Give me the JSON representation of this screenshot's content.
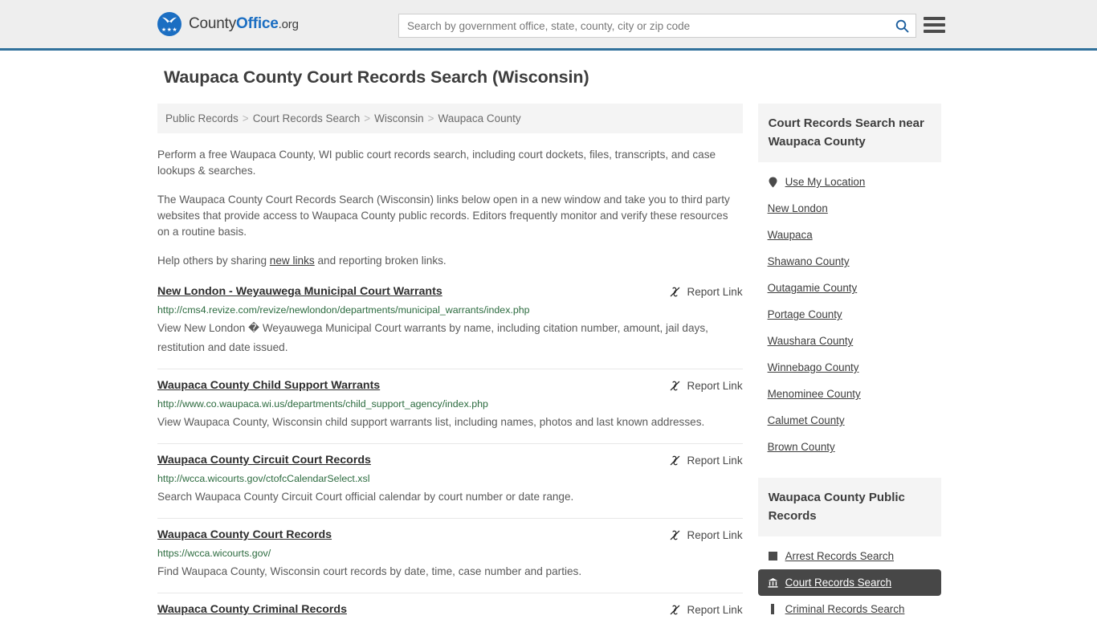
{
  "header": {
    "brand": {
      "part1": "County",
      "part2": "Office",
      "part3": ".org",
      "icon": "eagle-seal-logo",
      "stars": "★★★"
    },
    "search": {
      "placeholder": "Search by government office, state, county, city or zip code",
      "value": "",
      "icon": "search-icon"
    },
    "menu_icon": "hamburger-menu-icon",
    "accent_color": "#31719b",
    "bg_color": "#eeeeee"
  },
  "page": {
    "title": "Waupaca County Court Records Search (Wisconsin)"
  },
  "breadcrumb": {
    "separator": ">",
    "items": [
      {
        "label": "Public Records"
      },
      {
        "label": "Court Records Search"
      },
      {
        "label": "Wisconsin"
      },
      {
        "label": "Waupaca County"
      }
    ]
  },
  "intro": {
    "p1": "Perform a free Waupaca County, WI public court records search, including court dockets, files, transcripts, and case lookups & searches.",
    "p2": "The Waupaca County Court Records Search (Wisconsin) links below open in a new window and take you to third party websites that provide access to Waupaca County public records. Editors frequently monitor and verify these resources on a routine basis.",
    "p3_before": "Help others by sharing ",
    "p3_link": "new links",
    "p3_after": " and reporting broken links."
  },
  "results": {
    "report_label": "Report Link",
    "report_icon": "broken-link-icon",
    "items": [
      {
        "title": "New London - Weyauwega Municipal Court Warrants",
        "url": "http://cms4.revize.com/revize/newlondon/departments/municipal_warrants/index.php",
        "description": "View New London � Weyauwega Municipal Court warrants by name, including citation number, amount, jail days, restitution and date issued."
      },
      {
        "title": "Waupaca County Child Support Warrants",
        "url": "http://www.co.waupaca.wi.us/departments/child_support_agency/index.php",
        "description": "View Waupaca County, Wisconsin child support warrants list, including names, photos and last known addresses."
      },
      {
        "title": "Waupaca County Circuit Court Records",
        "url": "http://wcca.wicourts.gov/ctofcCalendarSelect.xsl",
        "description": "Search Waupaca County Circuit Court official calendar by court number or date range."
      },
      {
        "title": "Waupaca County Court Records",
        "url": "https://wcca.wicourts.gov/",
        "description": "Find Waupaca County, Wisconsin court records by date, time, case number and parties."
      },
      {
        "title": "Waupaca County Criminal Records",
        "url": "",
        "description": ""
      }
    ]
  },
  "sidebar": {
    "nearby": {
      "heading": "Court Records Search near Waupaca County",
      "items": [
        {
          "label": "Use My Location",
          "icon": "map-pin-icon"
        },
        {
          "label": "New London",
          "icon": ""
        },
        {
          "label": "Waupaca",
          "icon": ""
        },
        {
          "label": "Shawano County",
          "icon": ""
        },
        {
          "label": "Outagamie County",
          "icon": ""
        },
        {
          "label": "Portage County",
          "icon": ""
        },
        {
          "label": "Waushara County",
          "icon": ""
        },
        {
          "label": "Winnebago County",
          "icon": ""
        },
        {
          "label": "Menominee County",
          "icon": ""
        },
        {
          "label": "Calumet County",
          "icon": ""
        },
        {
          "label": "Brown County",
          "icon": ""
        }
      ]
    },
    "public_records": {
      "heading": "Waupaca County Public Records",
      "active_index": 1,
      "items": [
        {
          "label": "Arrest Records Search",
          "icon": "square-icon"
        },
        {
          "label": "Court Records Search",
          "icon": "courthouse-icon"
        },
        {
          "label": "Criminal Records Search",
          "icon": "bar-icon"
        }
      ]
    }
  }
}
